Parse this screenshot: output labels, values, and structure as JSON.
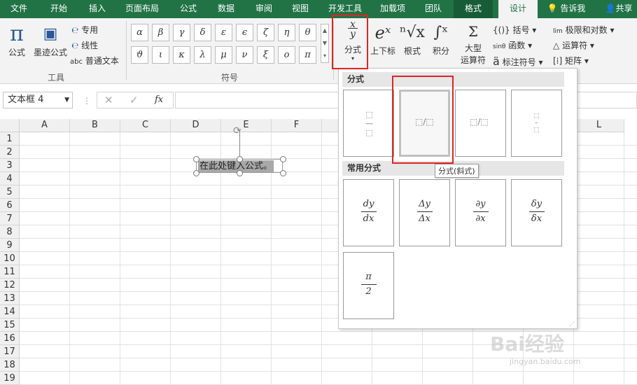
{
  "menubar": {
    "tabs": [
      "文件",
      "开始",
      "插入",
      "页面布局",
      "公式",
      "数据",
      "审阅",
      "视图",
      "开发工具",
      "加载项",
      "团队",
      "格式",
      "设计"
    ],
    "tellme": "告诉我",
    "share": "共享"
  },
  "ribbon": {
    "tools": {
      "equation": "公式",
      "ink": "墨迹公式",
      "professional": "专用",
      "linear": "线性",
      "normal_text": "普通文本",
      "normal_prefix": "abc",
      "group": "工具"
    },
    "symbols": {
      "row1": [
        "α",
        "β",
        "γ",
        "δ",
        "ε",
        "ϵ",
        "ζ",
        "η",
        "θ"
      ],
      "row2": [
        "ϑ",
        "ι",
        "κ",
        "λ",
        "μ",
        "ν",
        "ξ",
        "ο",
        "π"
      ],
      "group": "符号"
    },
    "structures": {
      "fraction": "分式",
      "script": "上下标",
      "radical": "根式",
      "integral": "积分",
      "large_op_line1": "大型",
      "large_op_line2": "运算符",
      "bracket": "括号",
      "function": "函数",
      "accent": "标注符号",
      "limit": "极限和对数",
      "operator": "运算符",
      "matrix": "矩阵"
    }
  },
  "formula_bar": {
    "name_box": "文本框 4",
    "fx": "fx"
  },
  "sheet": {
    "columns": [
      "A",
      "B",
      "C",
      "D",
      "E",
      "F",
      "",
      "",
      "",
      "",
      "",
      "L"
    ],
    "rows": [
      "1",
      "2",
      "3",
      "4",
      "5",
      "6",
      "7",
      "8",
      "9",
      "10",
      "11",
      "12",
      "13",
      "14",
      "15",
      "16",
      "17",
      "18",
      "19"
    ],
    "textbox_text": "在此处键入公式。"
  },
  "dropdown": {
    "section1": "分式",
    "section2": "常用分式",
    "tooltip": "分式(斜式)",
    "common": [
      {
        "num": "dy",
        "den": "dx"
      },
      {
        "num": "Δy",
        "den": "Δx"
      },
      {
        "num": "∂y",
        "den": "∂x"
      },
      {
        "num": "δy",
        "den": "δx"
      },
      {
        "num": "π",
        "den": "2"
      }
    ]
  },
  "watermark": {
    "text": "Bai经验",
    "sub": "jingyan.baidu.com"
  },
  "colors": {
    "accent": "#217346",
    "highlight": "#e02424"
  }
}
